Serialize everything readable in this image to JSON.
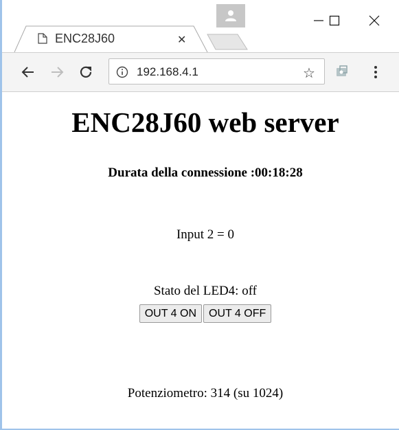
{
  "browser": {
    "tab": {
      "title": "ENC28J60"
    },
    "address_bar": {
      "url": "192.168.4.1"
    },
    "icons": {
      "page": "document-icon",
      "close_tab": "close-icon",
      "back": "back-arrow-icon",
      "forward": "forward-arrow-icon",
      "reload": "reload-icon",
      "info": "info-icon",
      "bookmark": "star-icon",
      "extension": "extension-icon",
      "menu": "kebab-menu-icon",
      "profile": "profile-avatar-icon",
      "minimize": "minimize-icon",
      "maximize": "maximize-icon",
      "close_window": "close-window-icon"
    }
  },
  "page": {
    "heading": "ENC28J60 web server",
    "duration": "Durata della connessione :00:18:28",
    "input_status": "Input 2 = 0",
    "led_status": "Stato del LED4: off",
    "buttons": {
      "on": "OUT 4 ON",
      "off": "OUT 4 OFF"
    },
    "potentiometer": "Potenziometro: 314 (su 1024)"
  },
  "colors": {
    "window_accent": "#9fc3ea",
    "toolbar_bg": "#f4f4f4",
    "avatar_bg": "#c7c7c7"
  }
}
